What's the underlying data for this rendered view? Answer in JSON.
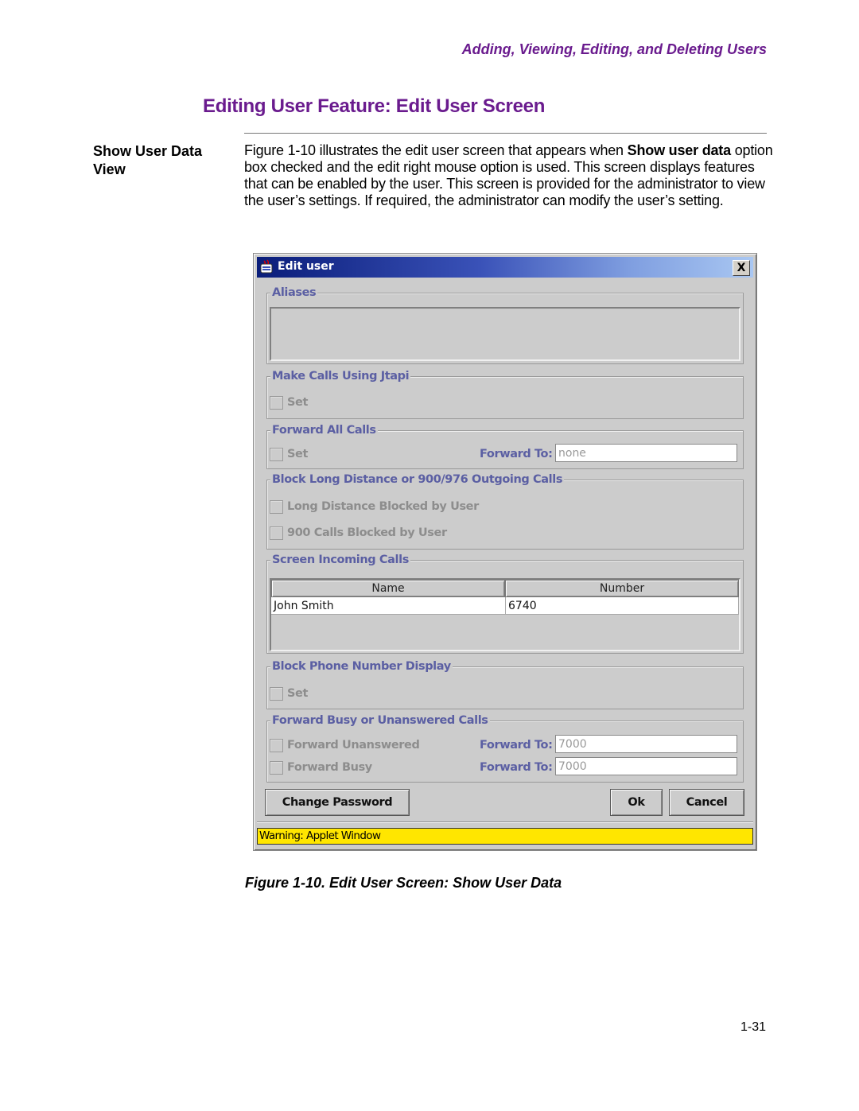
{
  "page": {
    "running_header": "Adding, Viewing, Editing, and Deleting Users",
    "section_title": "Editing User Feature: Edit User Screen",
    "side_head": [
      "Show User Data",
      "View"
    ],
    "body": {
      "p1_pre": "Figure 1-10 illustrates the edit user screen that appears when ",
      "p1_bold1": "Show user data",
      "p1_post": " option box checked and the edit right mouse option is used. This screen displays features that can be enabled by the user. This screen is provided for the administrator to view the user’s settings. If required, the administrator can modify the user’s setting."
    },
    "caption": "Figure 1-10. Edit User Screen: Show User Data",
    "page_number": "1-31"
  },
  "dialog": {
    "title": "Edit user",
    "close_label": "X",
    "groups": {
      "aliases": {
        "legend": "Aliases"
      },
      "jtapi": {
        "legend": "Make Calls Using Jtapi",
        "checkbox": "Set",
        "checked": false
      },
      "forward_all": {
        "legend": "Forward All Calls",
        "checkbox": "Set",
        "checked": false,
        "forward_label": "Forward To:",
        "forward_value": "none"
      },
      "block_ld": {
        "legend": "Block Long Distance or 900/976 Outgoing Calls",
        "checkbox1": "Long Distance Blocked by User",
        "checkbox2": "900 Calls Blocked by User"
      },
      "screen_incoming": {
        "legend": "Screen Incoming Calls",
        "columns": [
          "Name",
          "Number"
        ],
        "rows": [
          {
            "name": "John Smith",
            "number": "6740"
          }
        ]
      },
      "block_display": {
        "legend": "Block Phone Number Display",
        "checkbox": "Set"
      },
      "forward_busy": {
        "legend": "Forward Busy or Unanswered Calls",
        "checkbox1": "Forward Unanswered",
        "checkbox2": "Forward Busy",
        "forward_label": "Forward To:",
        "unanswered_value": "7000",
        "busy_value": "7000"
      }
    },
    "buttons": {
      "change_password": "Change Password",
      "ok": "Ok",
      "cancel": "Cancel"
    },
    "warning": "Warning: Applet Window",
    "colors": {
      "legend": "#5b5fa3",
      "warning_bg": "#ffe600",
      "title_bar_start": "#0a1d7a",
      "title_bar_end": "#a9c7f2",
      "heading": "#6a1b8e"
    }
  }
}
